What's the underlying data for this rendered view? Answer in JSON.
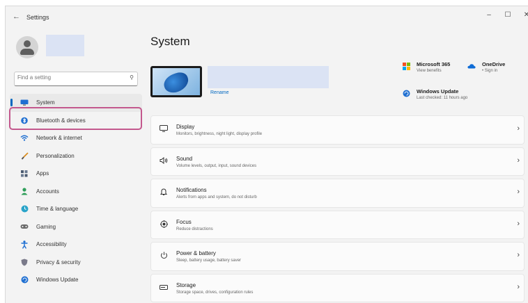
{
  "window": {
    "title": "Settings",
    "minimize": "–",
    "maximize": "☐",
    "close": "✕",
    "back": "←"
  },
  "sidebar": {
    "search": {
      "placeholder": "Find a setting"
    },
    "items": [
      {
        "label": "System",
        "icon": "monitor-icon",
        "selected": true
      },
      {
        "label": "Bluetooth & devices",
        "icon": "bluetooth-icon",
        "highlighted": true
      },
      {
        "label": "Network & internet",
        "icon": "wifi-icon"
      },
      {
        "label": "Personalization",
        "icon": "brush-icon"
      },
      {
        "label": "Apps",
        "icon": "apps-icon"
      },
      {
        "label": "Accounts",
        "icon": "person-icon"
      },
      {
        "label": "Time & language",
        "icon": "globe-clock-icon"
      },
      {
        "label": "Gaming",
        "icon": "gamepad-icon"
      },
      {
        "label": "Accessibility",
        "icon": "accessibility-icon"
      },
      {
        "label": "Privacy & security",
        "icon": "shield-icon"
      },
      {
        "label": "Windows Update",
        "icon": "update-icon"
      }
    ]
  },
  "main": {
    "title": "System",
    "rename": "Rename",
    "tiles": [
      {
        "title": "Microsoft 365",
        "sub": "View benefits",
        "icon": "microsoft-365-icon"
      },
      {
        "title": "OneDrive",
        "sub": "• Sign in",
        "icon": "onedrive-icon"
      },
      {
        "title": "Windows Update",
        "sub": "Last checked: 11 hours ago",
        "icon": "windows-update-icon"
      }
    ],
    "rows": [
      {
        "title": "Display",
        "sub": "Monitors, brightness, night light, display profile",
        "icon": "display-icon"
      },
      {
        "title": "Sound",
        "sub": "Volume levels, output, input, sound devices",
        "icon": "speaker-icon"
      },
      {
        "title": "Notifications",
        "sub": "Alerts from apps and system, do not disturb",
        "icon": "bell-icon"
      },
      {
        "title": "Focus",
        "sub": "Reduce distractions",
        "icon": "focus-icon"
      },
      {
        "title": "Power & battery",
        "sub": "Sleep, battery usage, battery saver",
        "icon": "power-icon"
      },
      {
        "title": "Storage",
        "sub": "Storage space, drives, configuration rules",
        "icon": "storage-icon"
      }
    ]
  },
  "colors": {
    "accent": "#0067c0",
    "highlight": "#c3588d"
  }
}
